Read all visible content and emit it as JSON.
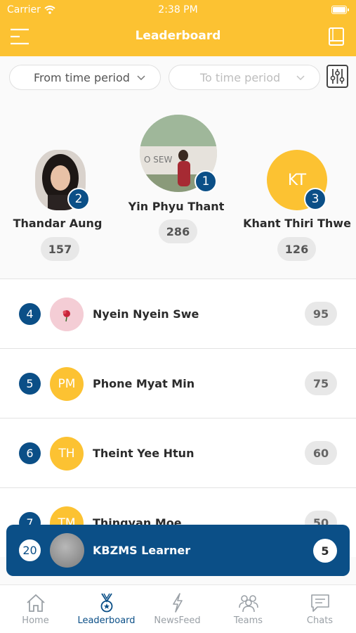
{
  "status_bar": {
    "carrier": "Carrier",
    "time": "2:38 PM"
  },
  "header": {
    "title": "Leaderboard",
    "menu_icon": "hamburger-menu-icon",
    "book_icon": "book-icon"
  },
  "filters": {
    "from_placeholder": "From time period",
    "to_placeholder": "To time period",
    "settings_icon": "sliders-icon"
  },
  "podium": {
    "first": {
      "rank": "1",
      "name": "Yin Phyu Thant",
      "score": "286"
    },
    "second": {
      "rank": "2",
      "name": "Thandar Aung",
      "score": "157"
    },
    "third": {
      "rank": "3",
      "name": "Khant Thiri Thwe",
      "initials": "KT",
      "score": "126"
    }
  },
  "list": [
    {
      "rank": "4",
      "name": "Nyein Nyein Swe",
      "initials": "",
      "score": "95"
    },
    {
      "rank": "5",
      "name": "Phone Myat Min",
      "initials": "PM",
      "score": "75"
    },
    {
      "rank": "6",
      "name": "Theint Yee Htun",
      "initials": "TH",
      "score": "60"
    },
    {
      "rank": "7",
      "name": "Thingyan Moe",
      "initials": "TM",
      "score": "50"
    }
  ],
  "current_user": {
    "rank": "20",
    "name": "KBZMS Learner",
    "score": "5"
  },
  "tabs": [
    {
      "label": "Home",
      "icon": "home-icon"
    },
    {
      "label": "Leaderboard",
      "icon": "medal-icon"
    },
    {
      "label": "NewsFeed",
      "icon": "lightning-icon"
    },
    {
      "label": "Teams",
      "icon": "team-icon"
    },
    {
      "label": "Chats",
      "icon": "chat-icon"
    }
  ],
  "colors": {
    "accent": "#fcc232",
    "primary": "#0b4f87"
  }
}
